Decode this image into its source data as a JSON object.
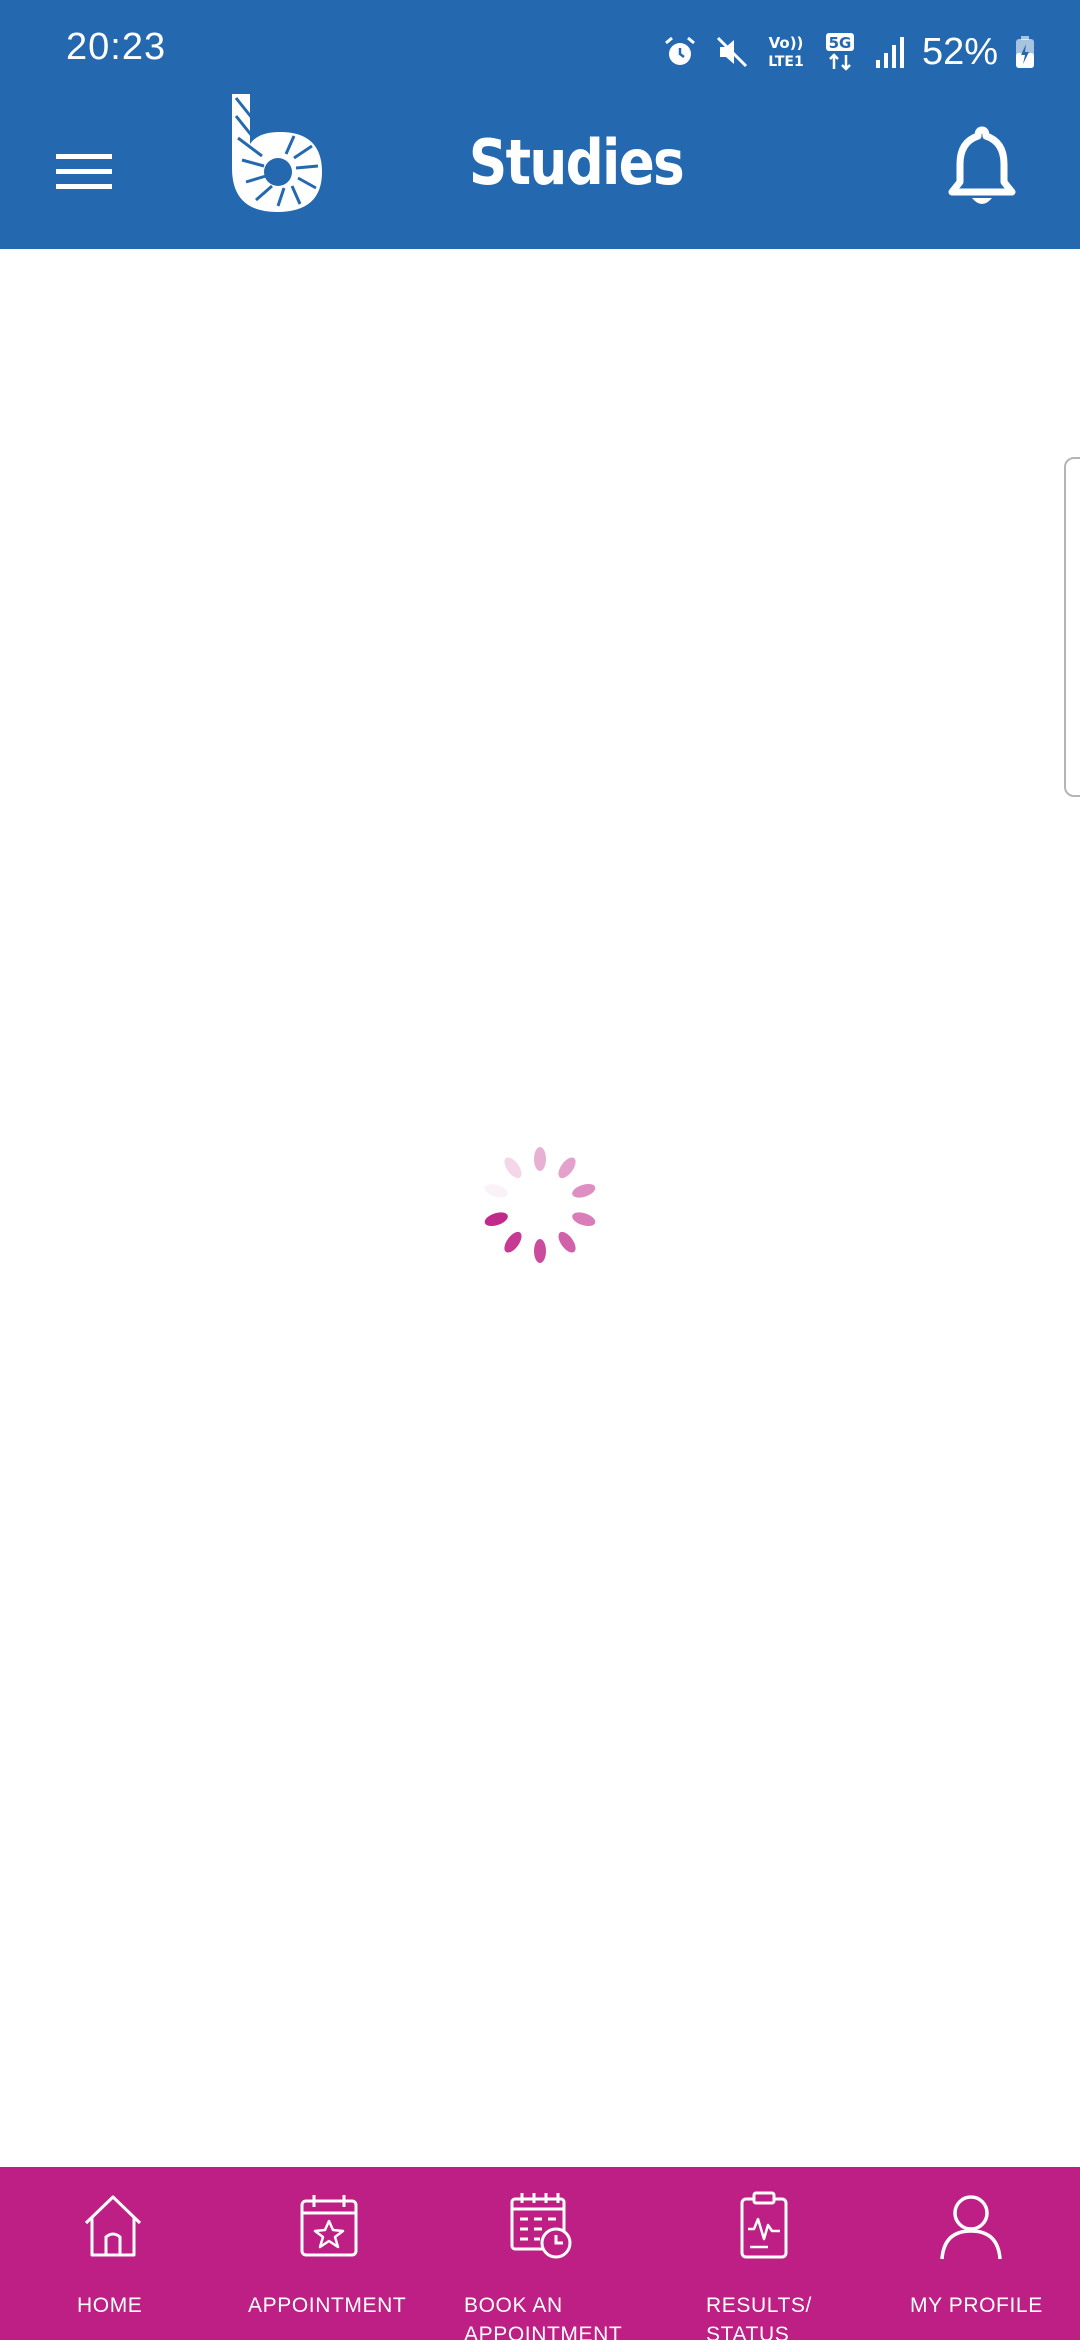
{
  "status_bar": {
    "time": "20:23",
    "battery_percent": "52%",
    "network_5g": "5G",
    "network_volte": "Vo))",
    "network_lte": "LTE1",
    "icons": [
      "alarm-icon",
      "mute-icon",
      "volte-icon",
      "5g-icon",
      "signal-icon",
      "battery-icon"
    ]
  },
  "header": {
    "title": "Studies",
    "menu_icon": "hamburger-menu-icon",
    "logo_icon": "b-logo-icon",
    "notification_icon": "bell-icon",
    "background_color": "#2469b0"
  },
  "content": {
    "loading_state": "loading-spinner",
    "spinner_color": "#be1f85"
  },
  "bottom_nav": {
    "background_color": "#be1f85",
    "items": [
      {
        "label": "HOME",
        "icon": "home-icon"
      },
      {
        "label": "APPOINTMENT",
        "icon": "calendar-star-icon"
      },
      {
        "label": "BOOK AN APPOINTMENT",
        "icon": "calendar-clock-icon"
      },
      {
        "label": "RESULTS/ STATUS",
        "icon": "clipboard-chart-icon"
      },
      {
        "label": "MY PROFILE",
        "icon": "person-icon"
      }
    ]
  }
}
